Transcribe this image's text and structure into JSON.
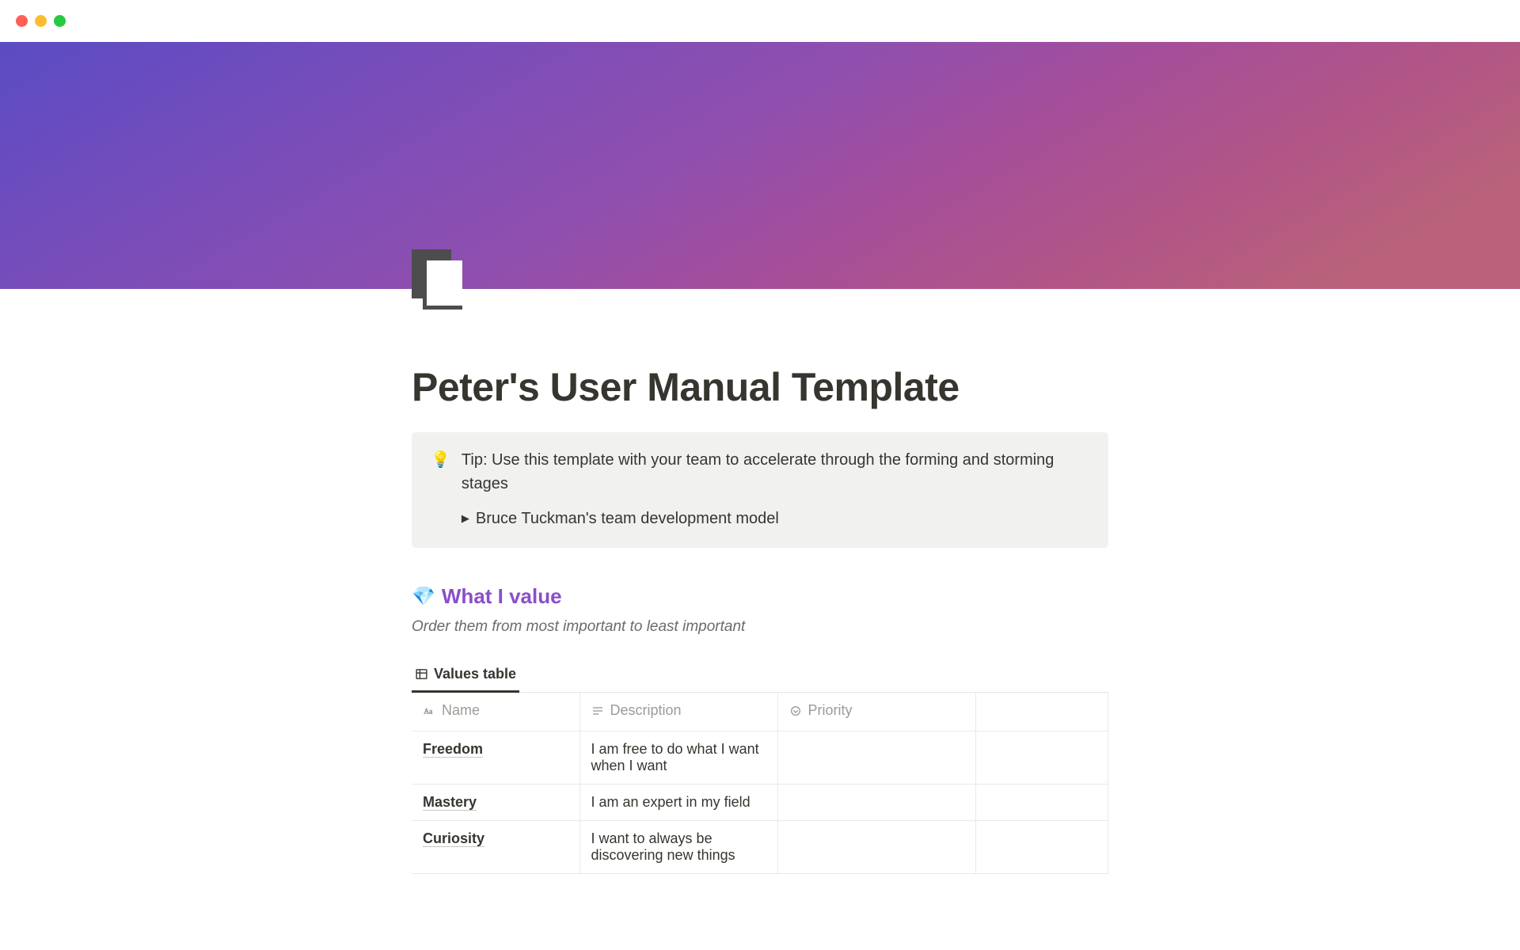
{
  "page": {
    "title": "Peter's User Manual Template"
  },
  "callout": {
    "icon": "💡",
    "text": "Tip: Use this template with your team to accelerate through the forming and storming stages",
    "toggle_label": "Bruce Tuckman's team development model"
  },
  "section_values": {
    "icon": "💎",
    "heading": "What I value",
    "subtitle": "Order them from most important to least important",
    "tab_label": "Values table",
    "columns": {
      "name": "Name",
      "description": "Description",
      "priority": "Priority"
    },
    "rows": [
      {
        "name": "Freedom",
        "description": "I am free to do what I want when I want",
        "priority": ""
      },
      {
        "name": "Mastery",
        "description": "I am an expert in my field",
        "priority": ""
      },
      {
        "name": "Curiosity",
        "description": "I want to always be discovering new things",
        "priority": ""
      }
    ]
  }
}
